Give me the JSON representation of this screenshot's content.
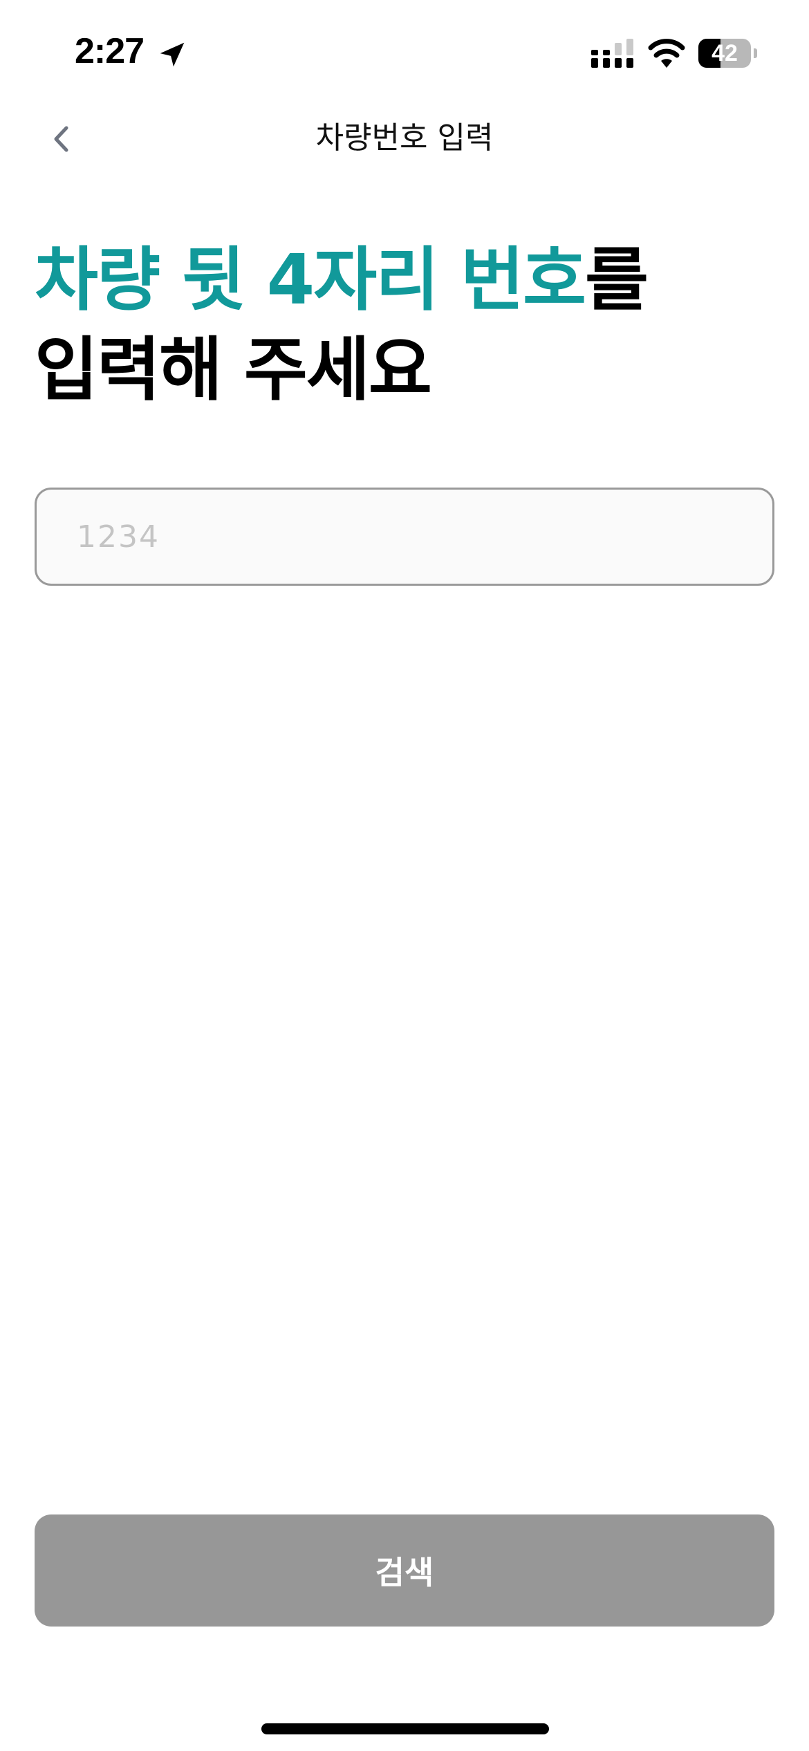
{
  "status_bar": {
    "time": "2:27",
    "battery_level": "42",
    "battery_fraction": 0.42
  },
  "nav": {
    "title": "차량번호 입력"
  },
  "heading": {
    "accent_text": "차량 뒷 4자리 번호",
    "rest_line1": "를",
    "line2": "입력해 주세요"
  },
  "input": {
    "placeholder": "1234",
    "value": ""
  },
  "search_button": {
    "label": "검색"
  },
  "colors": {
    "accent": "#11999a",
    "button_disabled": "#979797",
    "input_border": "#9a9a9a"
  },
  "icons": {
    "back": "chevron-left-icon",
    "location": "location-arrow-icon",
    "cellular": "cellular-signal-icon",
    "wifi": "wifi-icon",
    "battery": "battery-icon"
  }
}
